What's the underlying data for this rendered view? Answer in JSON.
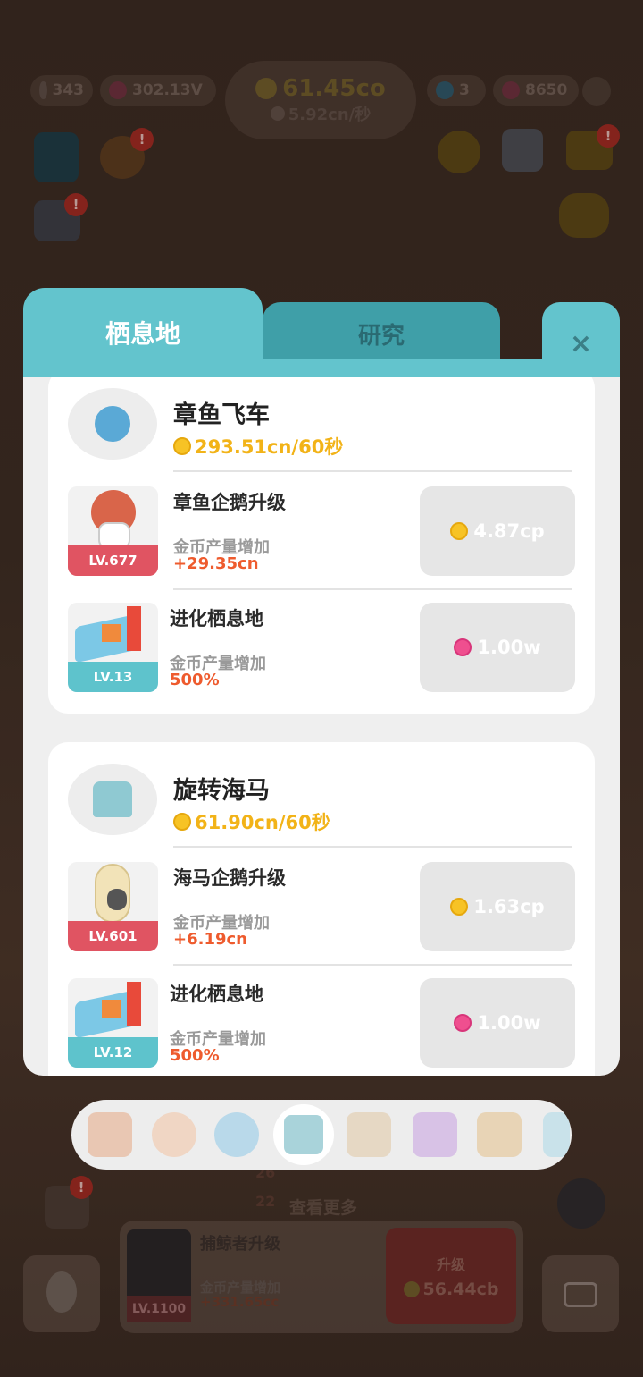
{
  "hud": {
    "stat1": "343",
    "stat2": "302.13V",
    "coins_main": "61.45co",
    "coins_rate": "5.92cn/秒",
    "energy": "3",
    "gems": "8650"
  },
  "badge": "!",
  "tabs": [
    {
      "label": "栖息地",
      "active": true
    },
    {
      "label": "研究",
      "active": false
    }
  ],
  "close_label": "×",
  "habitats": [
    {
      "name": "章鱼飞车",
      "rate": "293.51cn/60秒",
      "icon": "octopus-ride-icon",
      "upgrades": [
        {
          "title": "章鱼企鹅升级",
          "desc": "金币产量增加",
          "value": "+29.35cn",
          "level": "LV.677",
          "price": "4.87cp",
          "currency": "coin",
          "icon": "octopus-penguin-icon"
        },
        {
          "title": "进化栖息地",
          "desc": "金币产量增加",
          "value": "500%",
          "level": "LV.13",
          "price": "1.00w",
          "currency": "gem",
          "icon": "evolve-habitat-icon"
        }
      ]
    },
    {
      "name": "旋转海马",
      "rate": "61.90cn/60秒",
      "icon": "seahorse-carousel-icon",
      "upgrades": [
        {
          "title": "海马企鹅升级",
          "desc": "金币产量增加",
          "value": "+6.19cn",
          "level": "LV.601",
          "price": "1.63cp",
          "currency": "coin",
          "icon": "seahorse-penguin-icon"
        },
        {
          "title": "进化栖息地",
          "desc": "金币产量增加",
          "value": "500%",
          "level": "LV.12",
          "price": "1.00w",
          "currency": "gem",
          "icon": "evolve-habitat-icon"
        }
      ]
    }
  ],
  "background": {
    "counter_a": "26",
    "counter_b": "22",
    "view_more": "查看更多",
    "upgrade_title": "捕鲸者升级",
    "upgrade_desc": "金币产量增加",
    "upgrade_value": "+331.65cc",
    "upgrade_level": "LV.1100",
    "upgrade_button": "升级",
    "upgrade_price": "56.44cb"
  },
  "colors": {
    "teal": "#63c4cd",
    "teal_dark": "#3f9fa8",
    "coin": "#f2b318",
    "red_level": "#e05462",
    "orange_value": "#ee5b2e"
  }
}
